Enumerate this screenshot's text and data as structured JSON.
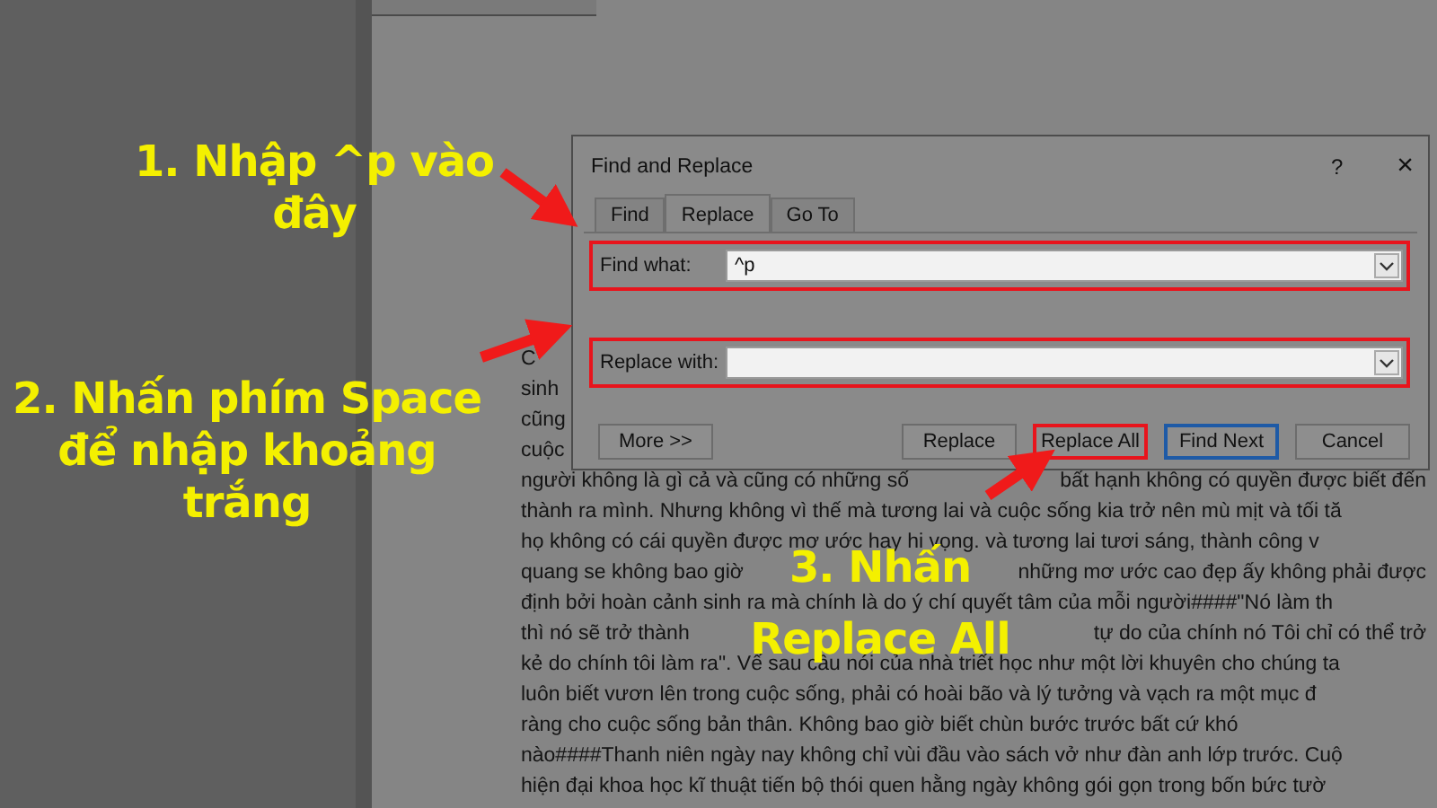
{
  "document": {
    "lines": [
      {
        "segments": [
          "C"
        ]
      },
      {
        "segments": [
          "sinh"
        ]
      },
      {
        "segments": [
          "cũng"
        ]
      },
      {
        "segments": [
          "cuộc"
        ]
      },
      {
        "segments": [
          "người không là gì cả và cũng có những số",
          "bất hạnh không có quyền được biết đến"
        ]
      },
      {
        "segments": [
          "thành ra mình. Nhưng không vì thế mà tương lai và cuộc sống kia trở nên mù mịt và tối tă"
        ]
      },
      {
        "segments": [
          "họ không có cái quyền được mơ ước hay hi vọng. và tương lai tươi sáng, thành công v"
        ]
      },
      {
        "segments": [
          "quang se không bao giờ",
          "những mơ ước cao đẹp ấy không phải được"
        ]
      },
      {
        "segments": [
          "định bởi hoàn cảnh sinh ra mà chính là do ý chí quyết tâm của mỗi người####\"Nó làm th"
        ]
      },
      {
        "segments": [
          "thì nó sẽ trở thành",
          "tự do của chính nó Tôi chỉ có thể trở"
        ]
      },
      {
        "segments": [
          "kẻ do chính tôi làm ra\". Vế sau câu nói của nhà triết học như một lời khuyên cho chúng ta"
        ]
      },
      {
        "segments": [
          "luôn biết vươn lên trong cuộc sống, phải có hoài bão và lý tưởng và vạch ra một mục đ"
        ]
      },
      {
        "segments": [
          "ràng cho cuộc sống bản thân. Không bao giờ biết chùn bước trước bất cứ khó"
        ]
      },
      {
        "segments": [
          "nào####Thanh niên ngày nay không chỉ vùi đầu vào sách vở như đàn anh lớp trước. Cuộ"
        ]
      },
      {
        "segments": [
          "hiện đại khoa học kĩ thuật tiến bộ thói quen hằng ngày không gói gọn trong bốn bức tườ"
        ]
      }
    ]
  },
  "dialog": {
    "title": "Find and Replace",
    "help": "?",
    "close": "×",
    "tabs": [
      {
        "label": "Find",
        "selected": false
      },
      {
        "label": "Replace",
        "selected": true
      },
      {
        "label": "Go To",
        "selected": false
      }
    ],
    "fields": [
      {
        "label": "Find what:",
        "value": "^p",
        "marked": true
      },
      {
        "label": "Replace with:",
        "marked": true
      }
    ],
    "buttons": [
      {
        "label": "More >>",
        "kind": "more",
        "default": false,
        "marked": false
      },
      {
        "label": "Replace",
        "kind": "action",
        "default": false,
        "marked": false
      },
      {
        "label": "Replace All",
        "kind": "action",
        "default": false,
        "marked": true
      },
      {
        "label": "Find Next",
        "kind": "action",
        "default": true,
        "marked": false
      },
      {
        "label": "Cancel",
        "kind": "action",
        "default": false,
        "marked": false
      }
    ]
  },
  "annotations": [
    {
      "lines": [
        "1. Nhập ^p vào",
        "đây"
      ]
    },
    {
      "lines": [
        "2. Nhấn phím Space",
        "để nhập khoảng",
        "trắng"
      ]
    },
    {
      "lines": [
        "3. Nhấn",
        "Replace All"
      ]
    }
  ]
}
